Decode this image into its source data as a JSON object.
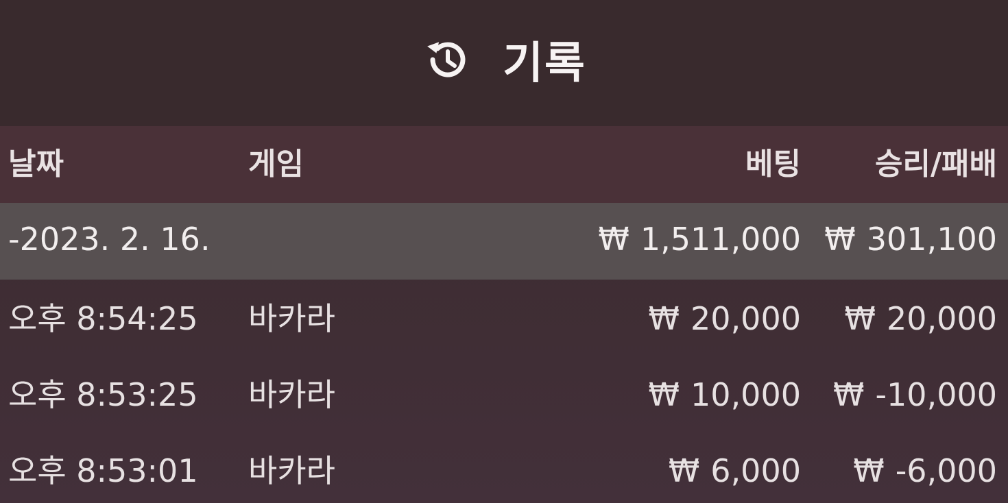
{
  "header": {
    "title": "기록",
    "icon": "history-icon"
  },
  "columns": {
    "date": "날짜",
    "game": "게임",
    "bet": "베팅",
    "result": "승리/패배"
  },
  "currency_symbol": "₩",
  "day_group": {
    "date": "-2023. 2. 16.",
    "bet_total": "1,511,000",
    "result_total": "301,100"
  },
  "rows": [
    {
      "time": "오후 8:54:25",
      "game": "바카라",
      "bet": "20,000",
      "result": "20,000"
    },
    {
      "time": "오후 8:53:25",
      "game": "바카라",
      "bet": "10,000",
      "result": "-10,000"
    },
    {
      "time": "오후 8:53:01",
      "game": "바카라",
      "bet": "6,000",
      "result": "-6,000"
    }
  ],
  "colors": {
    "header_bg": "#392a2d",
    "column_header_bg": "#4a3138",
    "date_row_bg": "#575051",
    "text": "#f3eeee"
  }
}
